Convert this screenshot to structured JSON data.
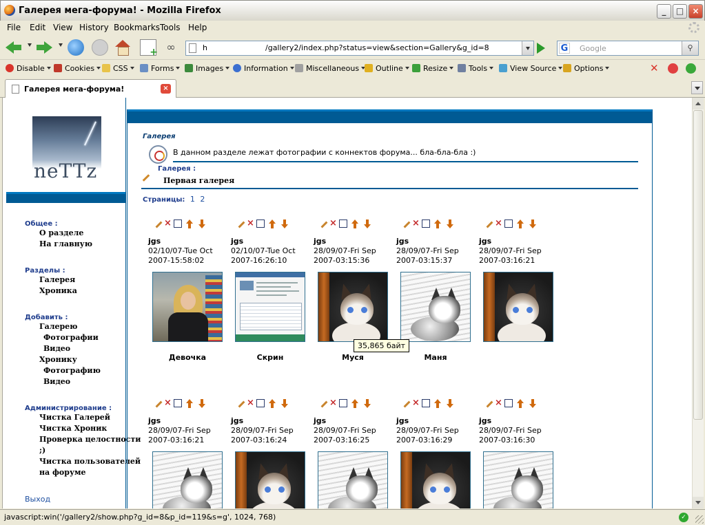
{
  "window": {
    "title": "Галерея мега-форума! - Mozilla Firefox",
    "controls": {
      "minimize": "_",
      "maximize": "□",
      "close": "×"
    }
  },
  "menu": [
    "File",
    "Edit",
    "View",
    "History",
    "Bookmarks",
    "Tools",
    "Help"
  ],
  "nav": {
    "url_prefix": "h",
    "url": "/gallery2/index.php?status=view&section=Gallery&g_id=8",
    "search_engine_letter": "G",
    "search_placeholder": "Google"
  },
  "devtoolbar": {
    "items": [
      "Disable",
      "Cookies",
      "CSS",
      "Forms",
      "Images",
      "Information",
      "Miscellaneous",
      "Outline",
      "Resize",
      "Tools",
      "View Source",
      "Options"
    ],
    "icon_colors": [
      "#d9352b",
      "#c0392b",
      "#e8c34a",
      "#6a8fc4",
      "#3c8a3c",
      "#3b6fd0",
      "#a0a0a0",
      "#e0b020",
      "#3ba03b",
      "#7080a0",
      "#4aa0d0",
      "#d8a520"
    ]
  },
  "tab": {
    "label": "Галерея мега-форума!",
    "close": "×"
  },
  "sidebar": {
    "logo_text": "neTTz",
    "sections": [
      {
        "title": "Общее :",
        "links": [
          "О разделе",
          "На главную"
        ]
      },
      {
        "title": "Разделы :",
        "links": [
          "Галерея",
          "Хроника"
        ]
      },
      {
        "title": "Добавить :",
        "links": [
          "Галерею",
          "Фотографии",
          "Видео",
          "Хронику",
          "Фотографию",
          "Видео"
        ]
      },
      {
        "title": "Администрирование :",
        "links": [
          "Чистка Галерей",
          "Чистка Хроник",
          "Проверка целостности",
          ";)",
          "Чистка пользователей",
          "на форуме"
        ]
      }
    ],
    "exit": "Выход"
  },
  "main": {
    "breadcrumb": "Галерея",
    "description": "В данном разделе лежат фотографии с коннектов форума... бла-бла-бла :)",
    "gallery_label": "Галерея :",
    "gallery_name": "Первая галерея",
    "pages_label": "Страницы:",
    "pages": [
      "1",
      "2"
    ]
  },
  "gallery": {
    "row1": [
      {
        "author": "jgs",
        "date1": "02/10/07-Tue Oct",
        "date2": "2007-15:58:02",
        "caption": "Девочка"
      },
      {
        "author": "jgs",
        "date1": "02/10/07-Tue Oct",
        "date2": "2007-16:26:10",
        "caption": "Скрин"
      },
      {
        "author": "jgs",
        "date1": "28/09/07-Fri Sep",
        "date2": "2007-03:15:36",
        "caption": "Муся"
      },
      {
        "author": "jgs",
        "date1": "28/09/07-Fri Sep",
        "date2": "2007-03:15:37",
        "caption": "Маня"
      },
      {
        "author": "jgs",
        "date1": "28/09/07-Fri Sep",
        "date2": "2007-03:16:21",
        "caption": ""
      }
    ],
    "row2": [
      {
        "author": "jgs",
        "date1": "28/09/07-Fri Sep",
        "date2": "2007-03:16:21"
      },
      {
        "author": "jgs",
        "date1": "28/09/07-Fri Sep",
        "date2": "2007-03:16:24"
      },
      {
        "author": "jgs",
        "date1": "28/09/07-Fri Sep",
        "date2": "2007-03:16:25"
      },
      {
        "author": "jgs",
        "date1": "28/09/07-Fri Sep",
        "date2": "2007-03:16:29"
      },
      {
        "author": "jgs",
        "date1": "28/09/07-Fri Sep",
        "date2": "2007-03:16:30"
      }
    ],
    "tooltip": "35,865 байт"
  },
  "status": {
    "text": "javascript:win('/gallery2/show.php?g_id=8&p_id=119&s=g', 1024, 768)",
    "ok_glyph": "✓"
  },
  "colors": {
    "accent": "#005a94",
    "link": "#1e4fa0",
    "section": "#1e3c8c"
  }
}
